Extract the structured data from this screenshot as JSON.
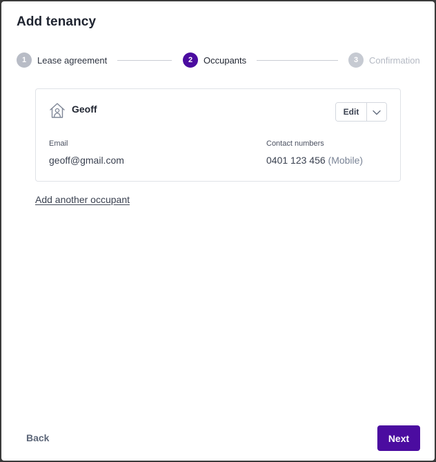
{
  "modal": {
    "title": "Add tenancy"
  },
  "stepper": {
    "steps": [
      {
        "number": "1",
        "label": "Lease agreement",
        "state": "completed"
      },
      {
        "number": "2",
        "label": "Occupants",
        "state": "active"
      },
      {
        "number": "3",
        "label": "Confirmation",
        "state": "pending"
      }
    ]
  },
  "occupant": {
    "name": "Geoff",
    "icon": "house-person-icon",
    "edit_label": "Edit",
    "email_label": "Email",
    "email": "geoff@gmail.com",
    "contact_label": "Contact numbers",
    "phone": "0401 123 456",
    "phone_type": "(Mobile)"
  },
  "actions": {
    "add_occupant": "Add another occupant",
    "back": "Back",
    "next": "Next"
  },
  "colors": {
    "accent": "#4b0ca0",
    "muted_text": "#7a8496",
    "border": "#dfe2e7"
  }
}
